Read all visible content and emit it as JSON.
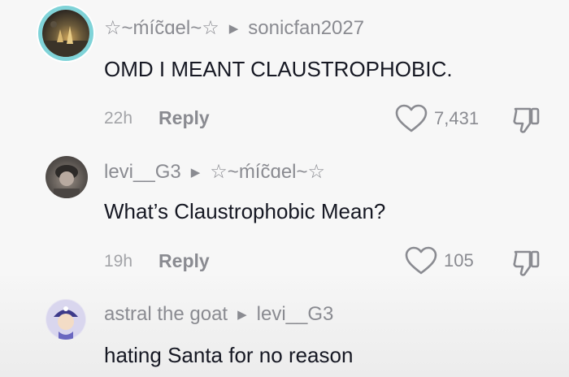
{
  "comments": [
    {
      "username": "☆~ḿíc̃ɑel~☆",
      "reply_to": "sonicfan2027",
      "text": "OMD I MEANT CLAUSTROPHOBIC.",
      "time": "22h",
      "reply_label": "Reply",
      "likes": "7,431"
    },
    {
      "username": "levi__G3",
      "reply_to": "☆~ḿíc̃ɑel~☆",
      "text": "What’s Claustrophobic Mean?",
      "time": "19h",
      "reply_label": "Reply",
      "likes": "105"
    },
    {
      "username": "astral the goat",
      "reply_to": "levi__G3",
      "text": "hating Santa for no reason"
    }
  ],
  "icons": {
    "reply_arrow": "caret-right-icon",
    "like": "heart-icon",
    "dislike": "thumbs-down-icon"
  },
  "colors": {
    "avatar_ring": "#7fd3d8",
    "text_primary": "#161823",
    "text_secondary": "#8a8b91"
  }
}
